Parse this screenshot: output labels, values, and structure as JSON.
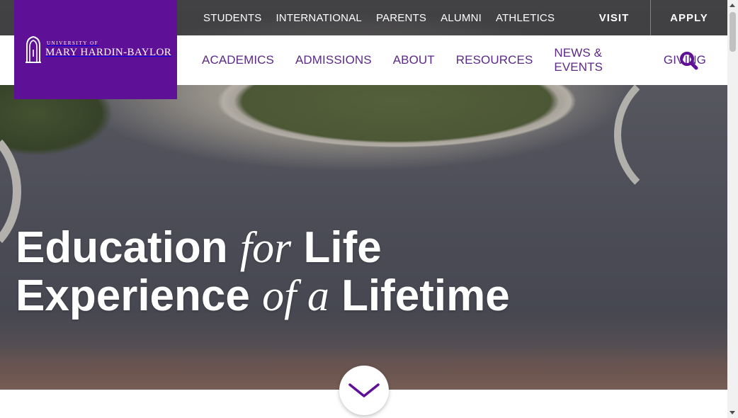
{
  "colors": {
    "brand_purple": "#5e1096",
    "nav_text": "#5b2a86",
    "white": "#ffffff"
  },
  "logo": {
    "line1": "UNIVERSITY OF",
    "line2": "MARY HARDIN-BAYLOR",
    "icon": "bell-tower-icon"
  },
  "utility_nav": {
    "links": [
      "STUDENTS",
      "INTERNATIONAL",
      "PARENTS",
      "ALUMNI",
      "ATHLETICS"
    ],
    "visit": "VISIT",
    "apply": "APPLY"
  },
  "main_nav": {
    "items": [
      "ACADEMICS",
      "ADMISSIONS",
      "ABOUT",
      "RESOURCES",
      "NEWS & EVENTS",
      "GIVING"
    ],
    "search_icon": "search-icon"
  },
  "hero": {
    "line1": {
      "a": "Education",
      "b": "for",
      "c": "Life"
    },
    "line2": {
      "a": "Experience",
      "b": "of a",
      "c": "Lifetime"
    },
    "scroll_icon": "chevron-down-icon"
  }
}
